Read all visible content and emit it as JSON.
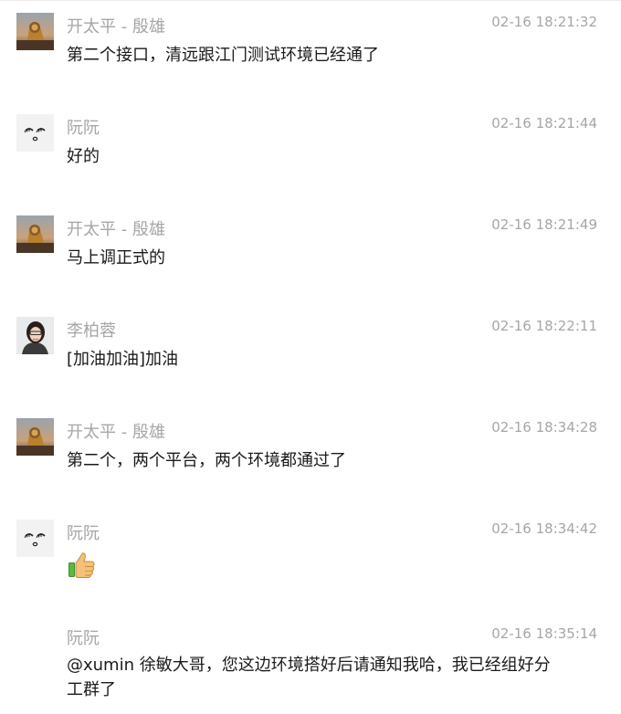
{
  "messages": [
    {
      "sender": "开太平 - 殷雄",
      "time": "02-16 18:21:32",
      "text": "第二个接口，清远跟江门测试环境已经通了",
      "avatar": "lion-avatar"
    },
    {
      "sender": "阮阮",
      "time": "02-16 18:21:44",
      "text": "好的",
      "avatar": "face-avatar"
    },
    {
      "sender": "开太平 - 殷雄",
      "time": "02-16 18:21:49",
      "text": "马上调正式的",
      "avatar": "lion-avatar"
    },
    {
      "sender": "李柏蓉",
      "time": "02-16 18:22:11",
      "text": "[加油加油]加油",
      "avatar": "woman-avatar"
    },
    {
      "sender": "开太平 - 殷雄",
      "time": "02-16 18:34:28",
      "text": "第二个，两个平台，两个环境都通过了",
      "avatar": "lion-avatar"
    },
    {
      "sender": "阮阮",
      "time": "02-16 18:34:42",
      "text": "",
      "emoji": "thumbs-up",
      "avatar": "face-avatar"
    },
    {
      "sender": "阮阮",
      "time": "02-16 18:35:14",
      "text": "@xumin 徐敏大哥，您这边环境搭好后请通知我哈，我已经组好分工群了",
      "avatar": "none"
    }
  ]
}
